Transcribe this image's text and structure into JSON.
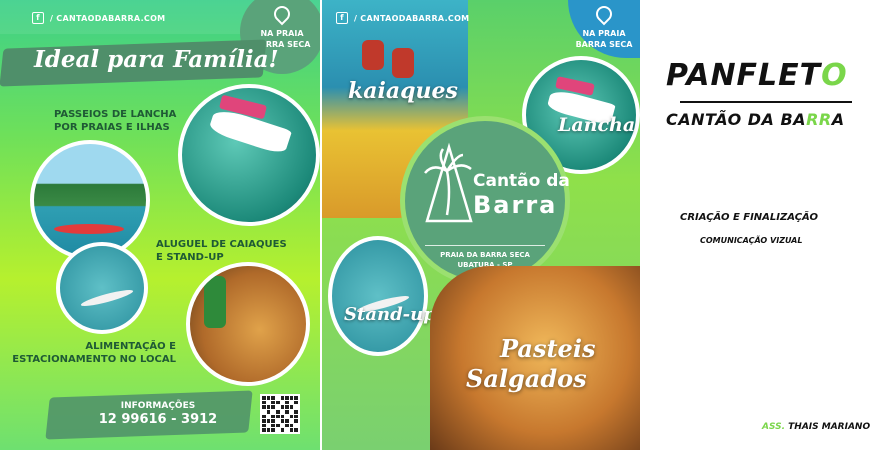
{
  "colors": {
    "green_dark": "#5aa37a",
    "green_accent": "#7ad64a",
    "blue_badge": "#2a95c9",
    "lime": "#b6f02e"
  },
  "front": {
    "social_handle": "/ CANTAODABARRA.COM",
    "location_badge": {
      "line1": "NA PRAIA",
      "line2": "BARRA SECA"
    },
    "headline": "Ideal para Família!",
    "caption_boat_line1": "PASSEIOS DE LANCHA",
    "caption_boat_line2": "POR PRAIAS E ILHAS",
    "caption_kayak_line1": "ALUGUEL DE CAIAQUES",
    "caption_kayak_line2": "E STAND-UP",
    "caption_food_line1": "ALIMENTAÇÃO E",
    "caption_food_line2": "ESTACIONAMENTO NO LOCAL",
    "info_label": "INFORMAÇÕES",
    "phone": "12 99616 - 3912"
  },
  "back": {
    "social_handle": "/ CANTAODABARRA.COM",
    "location_badge": {
      "line1": "NA PRAIA",
      "line2": "BARRA SECA"
    },
    "label_kayak": "kaiaques",
    "label_boat": "Lancha",
    "label_standup": "Stand-up",
    "label_pastel1": "Pasteis",
    "label_pastel2": "Salgados",
    "logo_line1": "Cantão da",
    "logo_line2": "Barra",
    "logo_place": "PRAIA DA BARRA SECA",
    "logo_city": "UBATUBA - SP"
  },
  "panel": {
    "title_main": "PANFLET",
    "title_accent": "O",
    "subtitle_main": "CANTÃO DA BA",
    "subtitle_accent": "RR",
    "subtitle_end": "A",
    "credit_line1": "CRIAÇÃO E FINALIZAÇÃO",
    "credit_line2": "COMUNICAÇÃO VIZUAL",
    "signature_prefix": "ASS.",
    "signature_name": " THAIS MARIANO"
  }
}
